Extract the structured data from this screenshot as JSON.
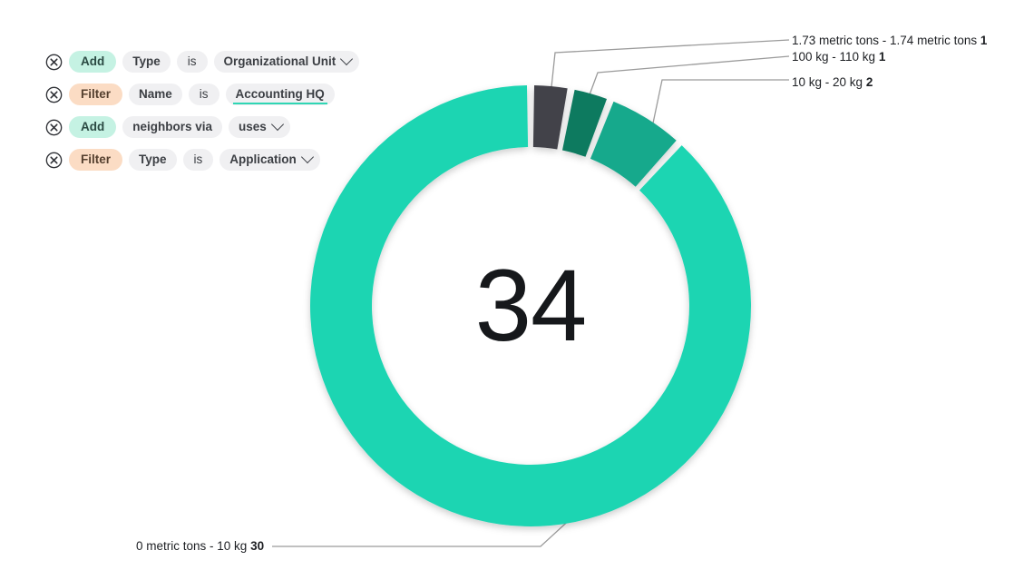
{
  "query_builder": {
    "rows": [
      {
        "remove_icon": "circle-x-icon",
        "verb": "Add",
        "verb_kind": "add",
        "attribute": "Type",
        "connector": "is",
        "value": "Organizational Unit",
        "value_kind": "select"
      },
      {
        "remove_icon": "circle-x-icon",
        "verb": "Filter",
        "verb_kind": "filter",
        "attribute": "Name",
        "connector": "is",
        "value": "Accounting HQ",
        "value_kind": "underline"
      },
      {
        "remove_icon": "circle-x-icon",
        "verb": "Add",
        "verb_kind": "add",
        "attribute": "neighbors via",
        "connector": "",
        "value": "uses",
        "value_kind": "select"
      },
      {
        "remove_icon": "circle-x-icon",
        "verb": "Filter",
        "verb_kind": "filter",
        "attribute": "Type",
        "connector": "is",
        "value": "Application",
        "value_kind": "select"
      }
    ]
  },
  "chart_data": {
    "type": "pie",
    "variant": "donut",
    "title": "",
    "center_value": "34",
    "total": 34,
    "categories": [
      "1.73 metric tons - 1.74 metric tons",
      "100 kg - 110 kg",
      "10 kg - 20 kg",
      "0 metric tons - 10 kg"
    ],
    "values": [
      1,
      1,
      2,
      30
    ],
    "colors": [
      "#42434a",
      "#0e7a5f",
      "#17a98c",
      "#1fd5b2"
    ],
    "labels": [
      {
        "text": "1.73 metric tons - 1.74 metric tons",
        "count": "1",
        "color": "#42434a"
      },
      {
        "text": "100 kg - 110 kg",
        "count": "1",
        "color": "#0e7a5f"
      },
      {
        "text": "10 kg - 20 kg",
        "count": "2",
        "color": "#17a98c"
      },
      {
        "text": "0 metric tons - 10 kg",
        "count": "30",
        "color": "#1fd5b2"
      }
    ],
    "legend_position": "callout-lines",
    "grid": false
  }
}
